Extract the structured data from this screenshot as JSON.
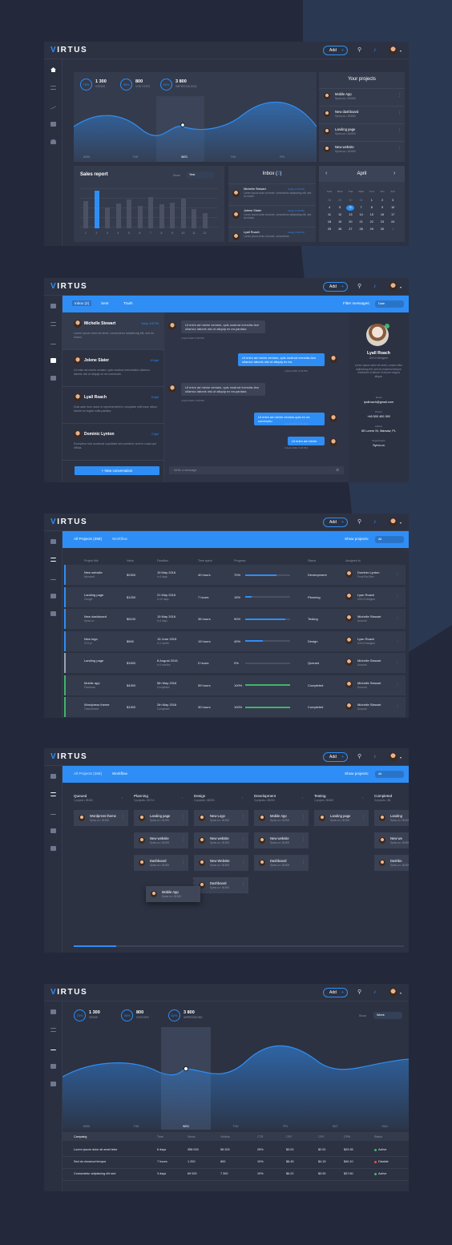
{
  "brand": {
    "logo_v": "V",
    "logo_rest": "IRTUS",
    "add_label": "Add",
    "plus": "+"
  },
  "dashboard": {
    "stats": [
      {
        "pct": "75%",
        "val": "1 300",
        "lbl": "VIEWS"
      },
      {
        "pct": "35%",
        "val": "800",
        "lbl": "VISITORS"
      },
      {
        "pct": "62%",
        "val": "3 800",
        "lbl": "IMPRESSIONS"
      }
    ],
    "days": [
      "MON",
      "TUE",
      "WED",
      "THU",
      "FRI"
    ],
    "projects_title": "Your projects",
    "projects": [
      {
        "name": "Mobile App",
        "sub": "Symu.co  •  $1500"
      },
      {
        "name": "New dashboard",
        "sub": "Symu.co  •  $1500"
      },
      {
        "name": "Landing page",
        "sub": "Symu.co  •  $1500"
      },
      {
        "name": "New website",
        "sub": "Symu.co  •  $1500"
      }
    ],
    "sales_title": "Sales report",
    "show_label": "Show:",
    "show_value": "Year",
    "sales_values": [
      55,
      75,
      42,
      50,
      58,
      45,
      62,
      48,
      52,
      60,
      38,
      30
    ],
    "sales_highlight": 2,
    "sales_months": [
      "1",
      "2",
      "3",
      "4",
      "5",
      "6",
      "7",
      "8",
      "9",
      "10",
      "11",
      "12"
    ],
    "inbox_title": "Inbox",
    "inbox_count": "2",
    "inbox": [
      {
        "name": "Michelle Stewart",
        "time": "Today, 5:32 PM",
        "text": "Lorem ipsum dolor sit amet, consectetur adipisicing elit, sed do eiusm"
      },
      {
        "name": "Jolene Slater",
        "time": "Today, 5:32 PM",
        "text": "Lorem ipsum dolor sit amet, consectetur adipisicing elit, sed do eiusm"
      },
      {
        "name": "Lyall Roach",
        "time": "Today, 5:32 PM",
        "text": "Lorem ipsum dolor sit amet, consectetur"
      }
    ],
    "calendar_month": "April",
    "prev": "‹",
    "next": "›",
    "calendar_dow": [
      "SUN",
      "MON",
      "TUE",
      "WED",
      "THU",
      "FRI",
      "SAT"
    ],
    "calendar_days": [
      "28",
      "29",
      "30",
      "31",
      "1",
      "2",
      "3",
      "4",
      "5",
      "6",
      "7",
      "8",
      "9",
      "10",
      "11",
      "12",
      "13",
      "14",
      "15",
      "16",
      "17",
      "18",
      "19",
      "20",
      "21",
      "22",
      "23",
      "24",
      "25",
      "26",
      "27",
      "28",
      "29",
      "30",
      "1"
    ],
    "calendar_today": "6"
  },
  "messages": {
    "tabs": [
      "Inbox (2)",
      "Sent",
      "Trash"
    ],
    "filter_label": "Filter messages:",
    "filter_value": "Date",
    "threads": [
      {
        "name": "Michelle Stewart",
        "time": "Today, 5:32 PM",
        "text": "Lorem ipsum dolor sit amet, consectetur adipisicing elit, sed do eiusm."
      },
      {
        "name": "Jolene Slater",
        "time": "10 April",
        "text": "Ut enim ad minim veniam, quis nostrud exercitation ullamco laboris nisi ut aliquip ex ea commodo."
      },
      {
        "name": "Lyall Roach",
        "time": "8 April",
        "text": "Duis aute irure dolor in reprehenderit in voluptate velit esse cillum dolore eu fugiat nulla pariatur."
      },
      {
        "name": "Dominic Lynton",
        "time": "2 April",
        "text": "Excepteur sint occaecat cupidatat non proident, sunt in culpa qui officia."
      }
    ],
    "new_conv": "+  New conversation",
    "chat": [
      {
        "side": "in",
        "text": "Ut enim ad minim veniam, quis nostrud exercita-tion ullamco laboris nisi ut aliquip ex ea pariatur.",
        "time": "4 April 2016, 5:33 PM"
      },
      {
        "side": "out",
        "text": "Ut enim ad minim veniam, quis nostrud exercita-tion ullamco laboris nisi ut aliquip ex ea.",
        "time": "4 April 2016, 5:32 PM"
      },
      {
        "side": "in",
        "text": "Ut enim ad minim veniam, quis nostrud exercita-tion ullamco laboris nisi ut aliquip ex ea pariatur.",
        "time": "4 April 2016, 5:33 PM"
      },
      {
        "side": "out",
        "text": "Ut enim ad minim veniam,quis ex ea commodo",
        "time": "4 April 2016, 5:32 PM"
      },
      {
        "side": "out",
        "text": "Ut enim ad minim",
        "time": "4 April 2016, 5:32 PM"
      }
    ],
    "write_placeholder": "Write a message",
    "profile": {
      "name": "Lyall Roach",
      "role": "UX/UI Designer",
      "about": "Lorem ipsum dolor sit amet, consec tetur adipisicing elit, sed do eiusmod tempor incididunt ut labore et dolore magna aliqua.",
      "email_l": "Email",
      "email": "lyallroach@gmail.com",
      "phone_l": "Phone",
      "phone": "+48 500 400 300",
      "addr_l": "Adress",
      "addr": "65 Lorem St, Warsaw, PL",
      "org_l": "Organization",
      "org": "Symu.co"
    }
  },
  "projects": {
    "tabs": [
      "All Projects (358)",
      "Workflow"
    ],
    "show_label": "Show projects:",
    "show_value": "All",
    "headers": [
      "Project title",
      "Value",
      "Deadline",
      "Time spent",
      "Progress",
      "Status",
      "Assigned to"
    ],
    "rows": [
      {
        "title": "New website",
        "sub": "Microsoft",
        "value": "$2300",
        "deadline": "15 May 2016",
        "dsub": "in 4 days",
        "time": "40 hours",
        "pct": "70%",
        "prog": 0.7,
        "status": "Development",
        "person": "Dominic Lynton",
        "role": "Front End Dev",
        "accent": "#2f8ef5",
        "pcol": "#2f8ef5"
      },
      {
        "title": "Landing page",
        "sub": "Google",
        "value": "$1250",
        "deadline": "21 May 2016",
        "dsub": "in 10 days",
        "time": "7 hours",
        "pct": "15%",
        "prog": 0.15,
        "status": "Planning",
        "person": "Lyan Roach",
        "role": "UX/UI Designer",
        "accent": "#2f8ef5",
        "pcol": "#2f8ef5"
      },
      {
        "title": "New dashboard",
        "sub": "Symu.co",
        "value": "$5100",
        "deadline": "15 May 2016",
        "dsub": "in 4 days",
        "time": "36 hours",
        "pct": "90%",
        "prog": 0.9,
        "status": "Testing",
        "person": "Michelle Stewart",
        "role": "Account",
        "accent": "#2f8ef5",
        "pcol": "#2f8ef5"
      },
      {
        "title": "New logo",
        "sub": "XYX.pl",
        "value": "$900",
        "deadline": "15 June 2015",
        "dsub": "in 1 month",
        "time": "15 hours",
        "pct": "40%",
        "prog": 0.4,
        "status": "Design",
        "person": "Lyan Roach",
        "role": "UX/UI Designer",
        "accent": "#2f8ef5",
        "pcol": "#2f8ef5"
      },
      {
        "title": "Landing page",
        "sub": "",
        "value": "$1500",
        "deadline": "8 August 2016",
        "dsub": "in 3 months",
        "time": "0 hours",
        "pct": "0%",
        "prog": 0,
        "status": "Queued",
        "person": "Michelle Stewart",
        "role": "Account",
        "accent": "#9aa3b5",
        "pcol": "#4b5163"
      },
      {
        "title": "Mobile app",
        "sub": "Facebook",
        "value": "$4300",
        "deadline": "5th May 2016",
        "dsub": "Completed",
        "time": "59 hours",
        "pct": "100%",
        "prog": 1,
        "status": "Completed",
        "person": "Michelle Stewart",
        "role": "Account",
        "accent": "#3fb56a",
        "pcol": "#3fb56a"
      },
      {
        "title": "Wordpress theme",
        "sub": "Themeforest",
        "value": "$1300",
        "deadline": "2th May 2016",
        "dsub": "Completed",
        "time": "30 hours",
        "pct": "100%",
        "prog": 1,
        "status": "Completed",
        "person": "Michelle Stewart",
        "role": "Account",
        "accent": "#3fb56a",
        "pcol": "#3fb56a"
      }
    ]
  },
  "workflow": {
    "columns": [
      {
        "name": "Queued",
        "sub": "1 project  •  $1500"
      },
      {
        "name": "Planning",
        "sub": "3 projects  •  $1710"
      },
      {
        "name": "Design",
        "sub": "2 projects  •  $3200"
      },
      {
        "name": "Development",
        "sub": "3 projects  •  $3200"
      },
      {
        "name": "Testing",
        "sub": "1 project  •  $1500"
      },
      {
        "name": "Completed",
        "sub": "3 projects  •  $5"
      }
    ],
    "cards": [
      [
        "Wordpress theme"
      ],
      [
        "Landing page",
        "New website",
        "Dashboard"
      ],
      [
        "New Logo",
        "New website",
        "New Website",
        "Dashboard"
      ],
      [
        "Mobile App",
        "New website",
        "Dashboard"
      ],
      [
        "Landing page"
      ],
      [
        "Landing",
        "New we",
        "Dashbo"
      ]
    ],
    "card_sub": "Symu.co  •  $1500",
    "drag_card": "Mobile App"
  },
  "analytics": {
    "show_label": "Show:",
    "show_value": "Week",
    "days": [
      "MON",
      "TUE",
      "WED",
      "THU",
      "FRI",
      "SAT",
      "SUN"
    ],
    "headers": [
      "Campaing",
      "Time",
      "Views",
      "Visitors",
      "CTR",
      "CPC",
      "CPV",
      "CPM",
      "Status"
    ],
    "rows": [
      [
        "Lorem ipsum dolor sit amet tetur",
        "6 days",
        "358 000",
        "58 200",
        "25%",
        "$3.02",
        "$2.51",
        "$29.35",
        "Active"
      ],
      [
        "Sed do eiusmod tempor",
        "7 hours",
        "1 200",
        "800",
        "10%",
        "$8.45",
        "$4.15",
        "$40.10",
        "Disable"
      ],
      [
        "Consectetur adipisicing elit sed",
        "3 days",
        "69 000",
        "7 300",
        "19%",
        "$6.22",
        "$3.90",
        "$37.60",
        "Active"
      ]
    ],
    "status_colors": [
      "#3fb56a",
      "#e84c4c",
      "#3fb56a"
    ]
  }
}
